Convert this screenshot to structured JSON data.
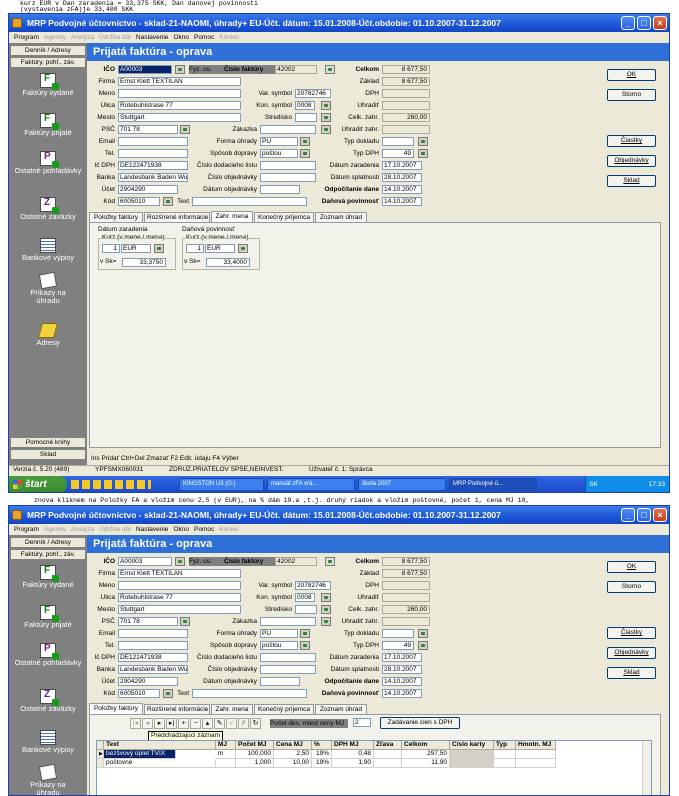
{
  "doc": {
    "top_lines": [
      "kurz EUR v Dan zaradenia = 33,375 SKK, Dan danovej povinnosti",
      "(vystavenia zFA)je 33,400 SKK"
    ],
    "middle_line": "znova kliknem na Položky FA a vložim cenu 2,5 (v EUR), na % dám 19.a ,t.j. druhý riadok a vložim poštovné, počet 1, cena MJ 10,"
  },
  "window": {
    "title": "MRP Podvojné účtovníctvo - sklad-21-NAOMI, úhrady+ EU-Účt. dátum: 15.01.2008-Účt.obdobie: 01.10.2007-31.12.2007",
    "minimize": "_",
    "maximize": "□",
    "close": "×"
  },
  "menu": [
    {
      "label": "Program",
      "disabled": false
    },
    {
      "label": "Agendy",
      "disabled": true
    },
    {
      "label": "Analýza",
      "disabled": true
    },
    {
      "label": "Údržba dát",
      "disabled": true
    },
    {
      "label": "Nastavenie",
      "disabled": false
    },
    {
      "label": "Okno",
      "disabled": false
    },
    {
      "label": "Pomoc",
      "disabled": false
    },
    {
      "label": "Koniec",
      "disabled": true
    }
  ],
  "sidebar": {
    "top1": "Denník / Adresy",
    "top2": "Faktúry, pohľ., záv.",
    "items": [
      {
        "label": "Faktúry vydané",
        "icon": "invoice-issued-icon"
      },
      {
        "label": "Faktúry prijaté",
        "icon": "invoice-received-icon"
      },
      {
        "label": "Ostatné pohľadávky",
        "icon": "receivables-icon"
      },
      {
        "label": "Ostatné záväzky",
        "icon": "liabilities-icon"
      },
      {
        "label": "Bankové výpisy",
        "icon": "bank-statement-icon"
      },
      {
        "label": "Príkazy na úhradu",
        "icon": "payment-order-icon"
      },
      {
        "label": "Adresy",
        "icon": "address-book-icon"
      }
    ],
    "bottom1": "Pomocné knihy",
    "bottom2": "Sklad"
  },
  "form": {
    "header": "Prijatá faktúra   -   oprava",
    "labels": {
      "ico": "IČO",
      "fyz_os": "Fyz. os.",
      "cislo_faktury": "Číslo faktúry",
      "firma": "Firma",
      "meno": "Meno",
      "ulica": "Ulica",
      "mesto": "Mesto",
      "psc": "PSČ",
      "email": "Email",
      "tel": "Tel.",
      "ic_dph": "Ič DPH",
      "banka": "Banka",
      "ucet": "Účet",
      "kod": "Kód",
      "text": "Text",
      "var_symbol": "Var. symbol",
      "kon_symbol": "Kon. symbol",
      "stredisko": "Stredisko",
      "zakazka": "Zákazka",
      "forma_uhrady": "Forma úhrady",
      "sposob_dopravy": "Spôsob dopravy",
      "cislo_dodacieho": "Číslo dodacieho listu",
      "cislo_objednavky": "Číslo objednávky",
      "datum_objednavky": "Dátum objednávky",
      "celkom": "Celkom",
      "zaklad": "Základ",
      "dph": "DPH",
      "uhradit": "Uhradiť",
      "celk_zahr": "Celk. zahr.",
      "uhradit_zahr": "Uhradiť zahr.",
      "typ_dokladu": "Typ dokladu",
      "typ_dph": "Typ DPH",
      "datum_zaradenia": "Dátum zaradenia",
      "datum_splatnosti": "Dátum splatnosti",
      "odpocitanie_dane": "Odpočítanie dane",
      "danova_povinnost": "Daňová povinnosť"
    },
    "values": {
      "ico": "A00003",
      "cislo_faktury": "42002",
      "firma": "Ernst Klett TEXTILAN",
      "meno": "",
      "ulica": "Rotebuhlstrase 77",
      "mesto": "Stuttgart",
      "psc": "701 78",
      "email": "",
      "tel": "",
      "ic_dph": "DE122471938",
      "banka": "Landesbank Baden Wu",
      "ucet": "2904290",
      "kod": "6005010",
      "text": "",
      "var_symbol": "20782746",
      "kon_symbol": "0008",
      "stredisko": "",
      "zakazka": "",
      "forma_uhrady": "PU",
      "sposob_dopravy": "poštou",
      "cislo_dodacieho": "",
      "cislo_objednavky": "",
      "datum_objednavky": "",
      "celkom": "8 677,50",
      "zaklad": "8 677,50",
      "dph": "",
      "uhradit": "",
      "celk_zahr": "260,00",
      "uhradit_zahr": "",
      "typ_dokladu": "",
      "typ_dph": "49",
      "datum_zaradenia": "17.10.2007",
      "datum_splatnosti": "28.10.2007",
      "odpocitanie_dane": "14.10.2007",
      "danova_povinnost": "14.10.2007"
    },
    "buttons": {
      "ok": "OK",
      "storno": "Storno",
      "ciastky": "Čiastky",
      "objednavky": "Objednávky",
      "sklad": "Sklad"
    },
    "tabs": [
      "Položky faktúry",
      "Rozšírené informácie",
      "Zahr. mena",
      "Konečný príjemca",
      "Zoznam úhrad"
    ]
  },
  "currency": {
    "datum_zaradenia": "Dátum zaradenia",
    "danova_povinnost": "Daňová povinnosť",
    "kurz_label": "Kurz (v mene / mena)",
    "vsk_label": "v Sk=",
    "zaradenia": {
      "amount": "1",
      "currency": "EUR",
      "rate": "33,3750"
    },
    "povinnost": {
      "amount": "1",
      "currency": "EUR",
      "rate": "33,4000"
    }
  },
  "status": {
    "hint": "Ins Pridať   Ctrl+Del Zmazať   F2 Edit. údaju   F4 Výber",
    "version": "Verzia č. 5.20 (489)",
    "code": "YPFSMX060031",
    "company": "ZDRUZ.PRIATELOV SPSE,NEINVEST.",
    "user": "Užívateľ č. 1: Správca"
  },
  "taskbar": {
    "start": "štart",
    "tasks": [
      "KINGSTON U3 (G:)",
      "manuál zFA vrá...",
      "škola 2007",
      "MRP Podvojné ú..."
    ],
    "lang": "SK",
    "time": "17:33"
  },
  "items": {
    "toolbar_labels": {
      "pocet_des": "Počet des. miest ceny MJ",
      "pocet_value": "2",
      "zadavanie": "Zadávanie cien s DPH"
    },
    "tooltip": "Predchádzajúci záznam",
    "columns": [
      "Text",
      "MJ",
      "Počet MJ",
      "Cena MJ",
      "%",
      "DPH MJ",
      "Zľava",
      "Celkom",
      "Číslo karty",
      "Typ",
      "Hmotn. MJ"
    ],
    "rows": [
      {
        "text": "bezšvový úplet TVIX",
        "mj": "m",
        "pocet": "100,000",
        "cena": "2,50",
        "pct": "19%",
        "dph": "0,48",
        "zlava": "",
        "celkom": "297,50",
        "karta": "",
        "typ": "",
        "hmotn": ""
      },
      {
        "text": "poštovné",
        "mj": "",
        "pocet": "1,000",
        "cena": "10,00",
        "pct": "19%",
        "dph": "1,90",
        "zlava": "",
        "celkom": "11,90",
        "karta": "",
        "typ": "",
        "hmotn": ""
      }
    ]
  }
}
